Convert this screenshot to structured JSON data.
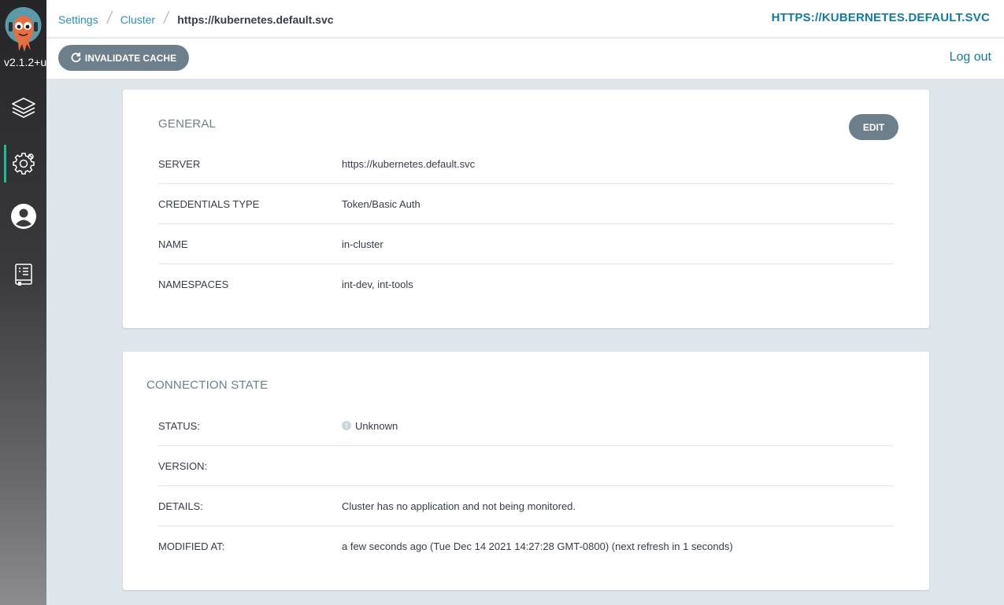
{
  "app": {
    "version": "v2.1.2+u"
  },
  "sidebar": {
    "items": [
      {
        "name": "applications",
        "icon": "layers-icon",
        "active": false
      },
      {
        "name": "settings",
        "icon": "gear-icon",
        "active": true
      },
      {
        "name": "user-info",
        "icon": "user-circle-icon",
        "active": false
      },
      {
        "name": "documentation",
        "icon": "book-icon",
        "active": false
      }
    ]
  },
  "header": {
    "breadcrumbs": [
      "Settings",
      "Cluster",
      "https://kubernetes.default.svc"
    ],
    "title": "HTTPS://KUBERNETES.DEFAULT.SVC"
  },
  "toolbar": {
    "invalidate_label": "INVALIDATE CACHE",
    "logout_label": "Log out"
  },
  "general": {
    "title": "GENERAL",
    "edit_label": "EDIT",
    "rows": [
      {
        "key": "SERVER",
        "value": "https://kubernetes.default.svc"
      },
      {
        "key": "CREDENTIALS TYPE",
        "value": "Token/Basic Auth"
      },
      {
        "key": "NAME",
        "value": "in-cluster"
      },
      {
        "key": "NAMESPACES",
        "value": "int-dev, int-tools"
      }
    ]
  },
  "connection": {
    "title": "CONNECTION STATE",
    "rows": [
      {
        "key": "STATUS:",
        "value": "Unknown"
      },
      {
        "key": "VERSION:",
        "value": ""
      },
      {
        "key": "DETAILS:",
        "value": "Cluster has no application and not being monitored."
      },
      {
        "key": "MODIFIED AT:",
        "value": "a few seconds ago (Tue Dec 14 2021 14:27:28 GMT-0800) (next refresh in 1 seconds)"
      }
    ]
  },
  "colors": {
    "accent": "#127ba2",
    "link": "#2b8fb5",
    "button": "#6d7f8b",
    "active_indicator": "#18be94"
  }
}
